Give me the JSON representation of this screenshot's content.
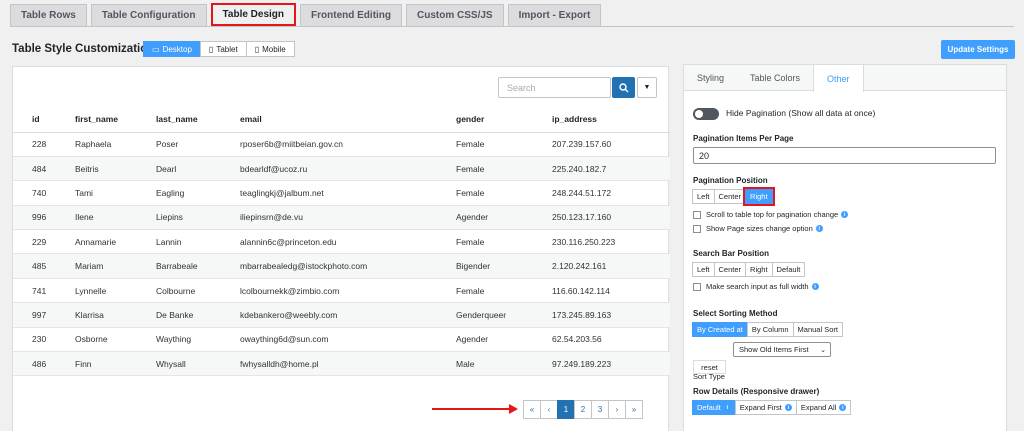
{
  "tabs": [
    {
      "label": "Table Rows"
    },
    {
      "label": "Table Configuration"
    },
    {
      "label": "Table Design",
      "active": true
    },
    {
      "label": "Frontend Editing"
    },
    {
      "label": "Custom CSS/JS"
    },
    {
      "label": "Import - Export"
    }
  ],
  "page_title": "Table Style Customization",
  "devices": [
    {
      "label": "Desktop",
      "icon": "desktop-icon"
    },
    {
      "label": "Tablet",
      "icon": "tablet-icon"
    },
    {
      "label": "Mobile",
      "icon": "mobile-icon"
    }
  ],
  "update_button": "Update Settings",
  "search": {
    "placeholder": "Search"
  },
  "table": {
    "columns": [
      "id",
      "first_name",
      "last_name",
      "email",
      "gender",
      "ip_address"
    ],
    "rows": [
      [
        "228",
        "Raphaela",
        "Poser",
        "rposer6b@miitbeian.gov.cn",
        "Female",
        "207.239.157.60"
      ],
      [
        "484",
        "Beitris",
        "Dearl",
        "bdearldf@ucoz.ru",
        "Female",
        "225.240.182.7"
      ],
      [
        "740",
        "Tami",
        "Eagling",
        "teaglingkj@jalbum.net",
        "Female",
        "248.244.51.172"
      ],
      [
        "996",
        "Ilene",
        "Liepins",
        "iliepinsrn@de.vu",
        "Agender",
        "250.123.17.160"
      ],
      [
        "229",
        "Annamarie",
        "Lannin",
        "alannin6c@princeton.edu",
        "Female",
        "230.116.250.223"
      ],
      [
        "485",
        "Mariam",
        "Barrabeale",
        "mbarrabealedg@istockphoto.com",
        "Bigender",
        "2.120.242.161"
      ],
      [
        "741",
        "Lynnelle",
        "Colbourne",
        "lcolbournekk@zimbio.com",
        "Female",
        "116.60.142.114"
      ],
      [
        "997",
        "Klarrisa",
        "De Banke",
        "kdebankero@weebly.com",
        "Genderqueer",
        "173.245.89.163"
      ],
      [
        "230",
        "Osborne",
        "Waything",
        "owaything6d@sun.com",
        "Agender",
        "62.54.203.56"
      ],
      [
        "486",
        "Finn",
        "Whysall",
        "fwhysalldh@home.pl",
        "Male",
        "97.249.189.223"
      ]
    ]
  },
  "pagination": [
    "«",
    "‹",
    "1",
    "2",
    "3",
    "›",
    "»"
  ],
  "settings_tabs": [
    {
      "label": "Styling"
    },
    {
      "label": "Table Colors"
    },
    {
      "label": "Other",
      "active": true
    }
  ],
  "settings": {
    "hide_pagination": "Hide Pagination (Show all data at once)",
    "items_per_page_label": "Pagination Items Per Page",
    "items_per_page_value": "20",
    "position_label": "Pagination Position",
    "position_options": [
      "Left",
      "Center",
      "Right"
    ],
    "scroll_top": "Scroll to table top for pagination change",
    "show_page_sizes": "Show Page sizes change option",
    "search_bar_label": "Search Bar Position",
    "search_bar_options": [
      "Left",
      "Center",
      "Right",
      "Default"
    ],
    "search_full_width": "Make search input as full width",
    "sorting_label": "Select Sorting Method",
    "sorting_options": [
      "By Created at",
      "By Column",
      "Manual Sort"
    ],
    "sort_type_label": "Sort Type",
    "sort_type_value": "Show Old Items First",
    "reset": "reset",
    "row_details_label": "Row Details (Responsive drawer)",
    "row_details_options": [
      "Default",
      "Expand First",
      "Expand All"
    ]
  },
  "colors": {
    "accent": "#409eff",
    "primary": "#2271b1",
    "highlight": "#e4161b"
  }
}
